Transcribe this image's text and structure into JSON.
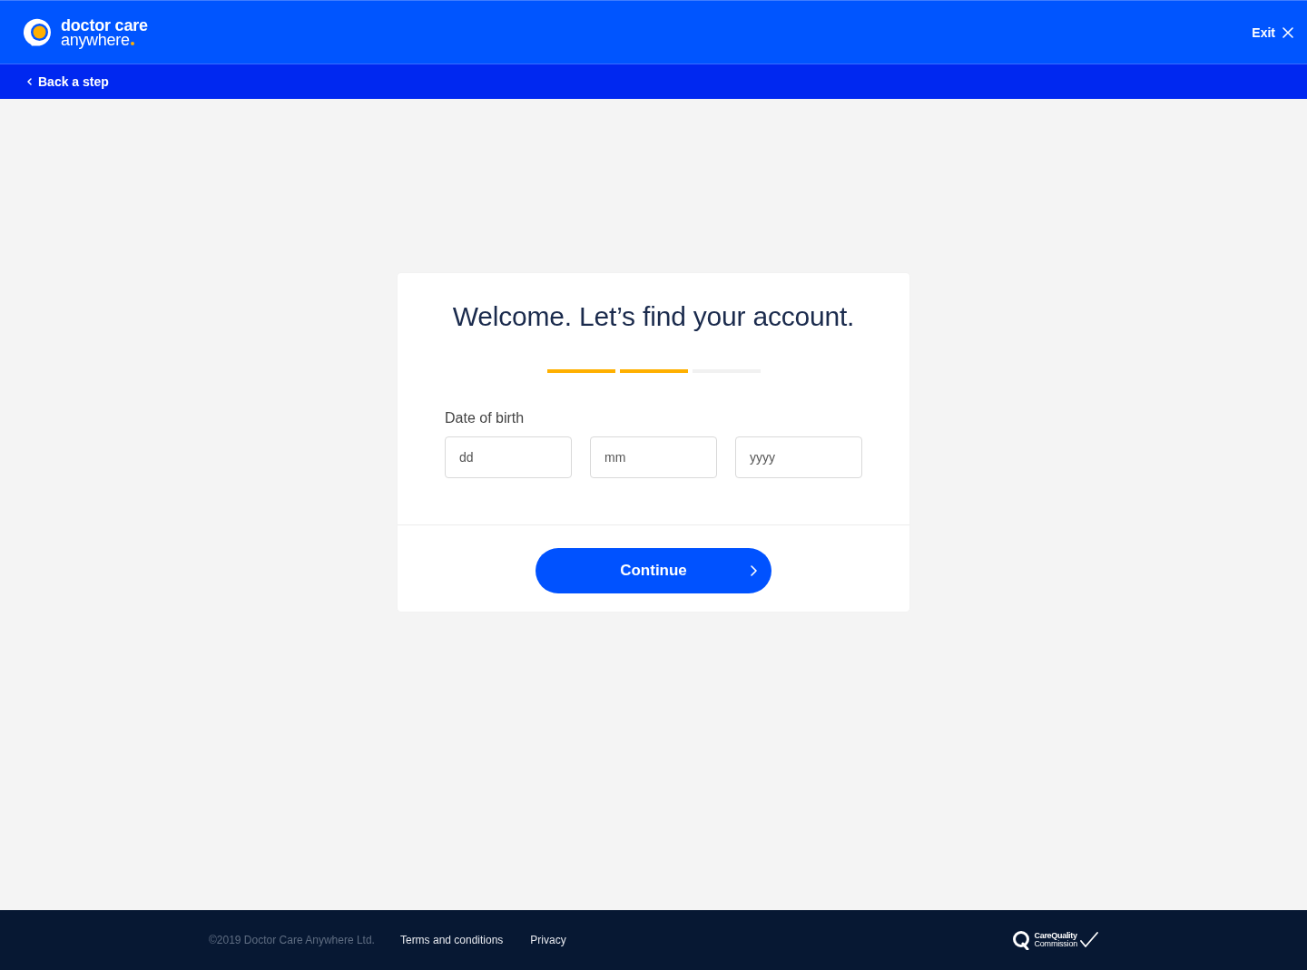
{
  "header": {
    "logo": {
      "line_1": "doctor care",
      "line_2": "anywhere"
    },
    "exit_button": {
      "label": "Exit"
    }
  },
  "subnav": {
    "back_link": {
      "label": "Back a step"
    }
  },
  "card": {
    "title": "Welcome. Let’s find your account.",
    "progress_steps": [
      {
        "done": true
      },
      {
        "done": true
      },
      {
        "done": false
      }
    ],
    "date_of_birth": {
      "label": "Date of birth",
      "fields": [
        {
          "placeholder": "dd"
        },
        {
          "placeholder": "mm"
        },
        {
          "placeholder": "yyyy"
        }
      ]
    },
    "continue_button": {
      "label": "Continue"
    }
  },
  "footer": {
    "copyright": "©2019 Doctor Care Anywhere Ltd.",
    "links": [
      {
        "label": "Terms and conditions"
      },
      {
        "label": "Privacy"
      }
    ],
    "regulator_logo": {
      "line_1": "CareQuality",
      "line_2": "Commission"
    }
  }
}
